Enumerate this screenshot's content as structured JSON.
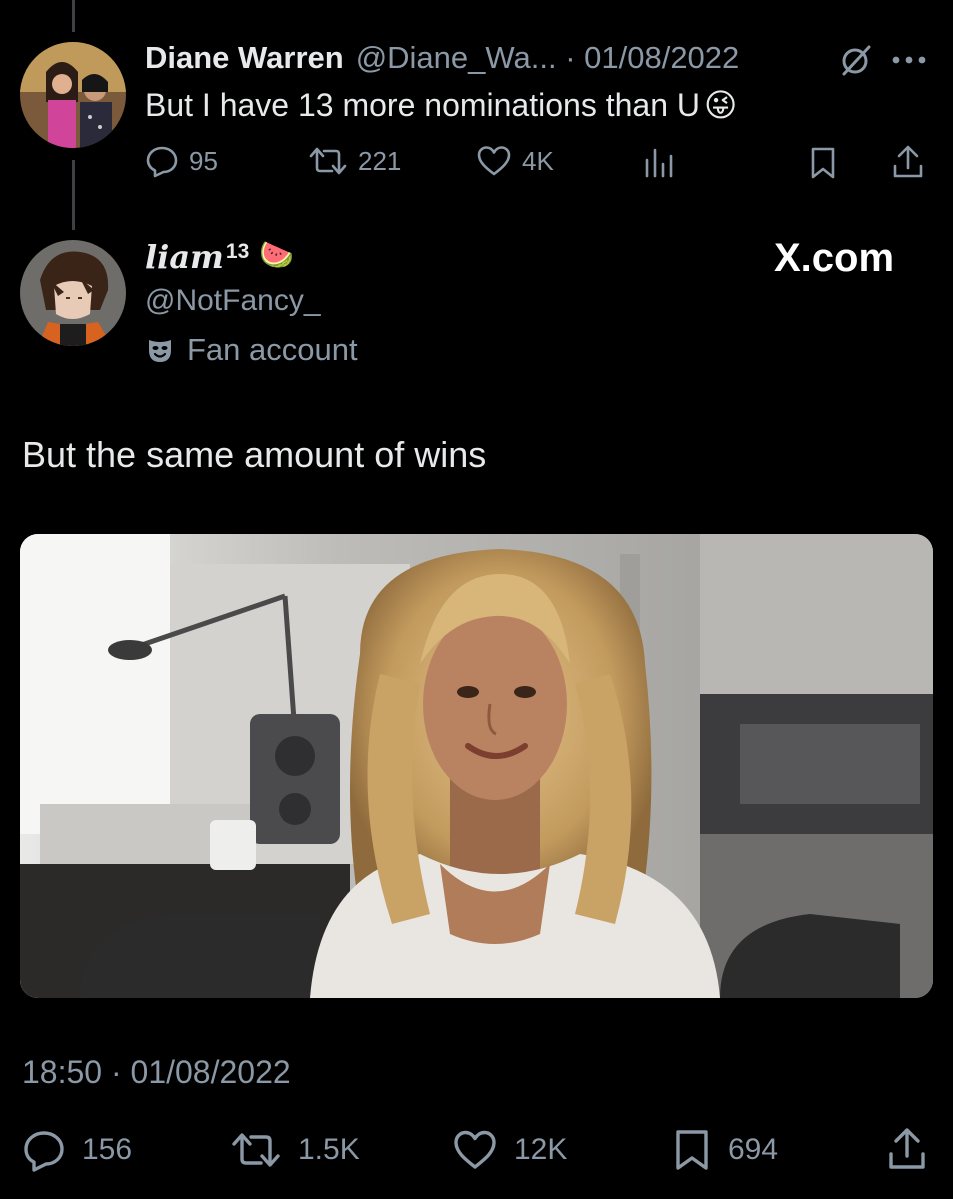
{
  "quoted_tweet": {
    "author_name": "Diane Warren",
    "handle_date": "@Diane_Wa... · 01/08/2022",
    "text": "But I have 13 more nominations than U",
    "emoji": "😜",
    "stats": {
      "replies": "95",
      "retweets": "221",
      "likes": "4K"
    }
  },
  "tweet": {
    "author_name": "liam",
    "author_superscript": "13",
    "author_emoji": "🍉",
    "handle": "@NotFancy_",
    "badge_label": "Fan account",
    "watermark": "X.com",
    "text": "But the same amount of wins",
    "timestamp": "18:50 · 01/08/2022",
    "stats": {
      "replies": "156",
      "retweets": "1.5K",
      "likes": "12K",
      "bookmarks": "694"
    }
  },
  "icons": [
    "reply-icon",
    "retweet-icon",
    "like-icon",
    "views-icon",
    "bookmark-icon",
    "share-icon",
    "more-icon",
    "grok-icon",
    "mask-icon"
  ],
  "colors": {
    "background": "#000000",
    "text": "#e7e9ea",
    "muted": "#8b98a5",
    "thread_line": "#3e4144"
  }
}
